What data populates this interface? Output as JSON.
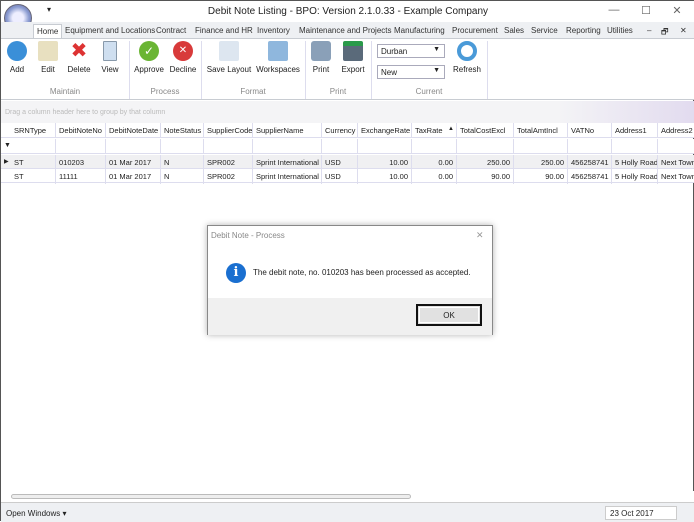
{
  "window": {
    "title": "Debit Note Listing - BPO: Version 2.1.0.33 - Example Company",
    "quick_access": "▾",
    "minimize": "—",
    "maximize": "☐",
    "close": "✕",
    "mdi_min": "–",
    "mdi_restore": "🗗",
    "mdi_close": "✕"
  },
  "tabs": [
    "Home",
    "Equipment and Locations",
    "Contract",
    "Finance and HR",
    "Inventory",
    "Maintenance and Projects",
    "Manufacturing",
    "Procurement",
    "Sales",
    "Service",
    "Reporting",
    "Utilities"
  ],
  "ribbon": {
    "buttons": {
      "add": "Add",
      "edit": "Edit",
      "delete": "Delete",
      "view": "View",
      "approve": "Approve",
      "decline": "Decline",
      "save_layout": "Save Layout",
      "workspaces": "Workspaces",
      "print": "Print",
      "export": "Export",
      "refresh": "Refresh"
    },
    "groups": {
      "maintain": "Maintain",
      "process": "Process",
      "format": "Format",
      "print": "Print",
      "current": "Current"
    },
    "site_combo": "Durban",
    "status_combo": "New"
  },
  "grid": {
    "group_hint": "Drag a column header here to group by that column",
    "columns": [
      "SRNType",
      "DebitNoteNo",
      "DebitNoteDate",
      "NoteStatus",
      "SupplierCode",
      "SupplierName",
      "Currency",
      "ExchangeRate",
      "TaxRate",
      "TotalCostExcl",
      "TotalAmtIncl",
      "VATNo",
      "Address1",
      "Address2"
    ],
    "sort_indicator": "▲",
    "rows": [
      [
        "ST",
        "010203",
        "01 Mar 2017",
        "N",
        "SPR002",
        "Sprint International",
        "USD",
        "10.00",
        "0.00",
        "250.00",
        "250.00",
        "456258741",
        "5 Holly Road",
        "Next Town"
      ],
      [
        "ST",
        "11111",
        "01 Mar 2017",
        "N",
        "SPR002",
        "Sprint International",
        "USD",
        "10.00",
        "0.00",
        "90.00",
        "90.00",
        "456258741",
        "5 Holly Road",
        "Next Town"
      ]
    ]
  },
  "dialog": {
    "title": "Debit Note - Process",
    "message": "The debit note, no. 010203 has been processed as accepted.",
    "ok": "OK",
    "close": "✕"
  },
  "status": {
    "open_windows": "Open Windows ▾",
    "date": "23 Oct 2017"
  }
}
